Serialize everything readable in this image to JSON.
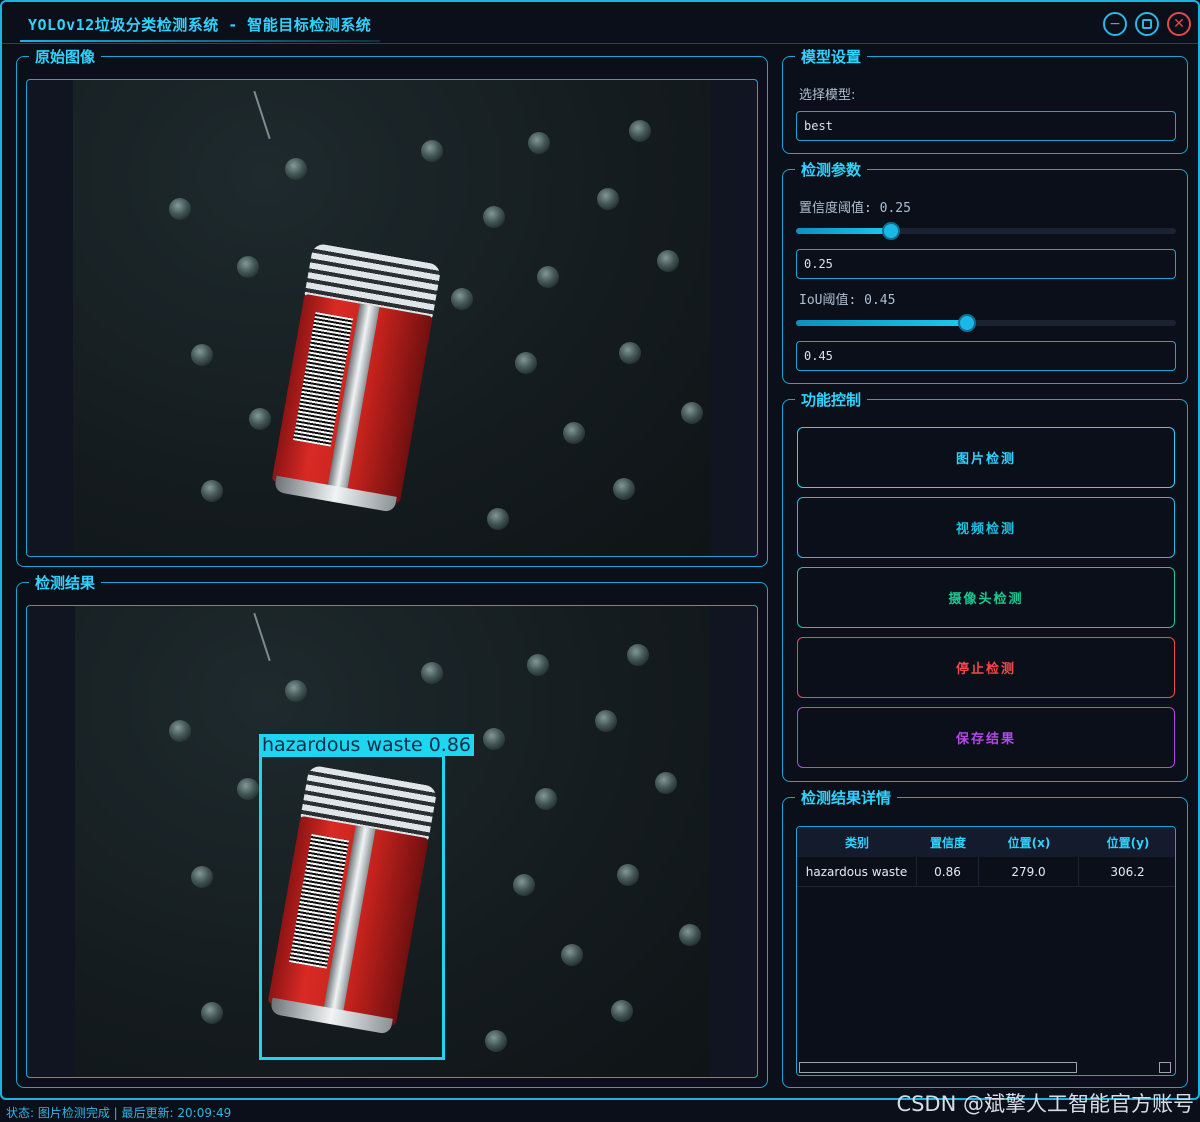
{
  "window": {
    "title": "YOLOv12垃圾分类检测系统 - 智能目标检测系统",
    "controls": [
      "minimize",
      "maximize",
      "close"
    ]
  },
  "panels": {
    "original": {
      "title": "原始图像"
    },
    "result": {
      "title": "检测结果"
    }
  },
  "detection_overlay": {
    "label": "hazardous waste 0.86",
    "color": "#1ed6f0"
  },
  "model": {
    "group_title": "模型设置",
    "select_label": "选择模型:",
    "selected": "best"
  },
  "params": {
    "group_title": "检测参数",
    "confidence_label": "置信度阈值: 0.25",
    "confidence_value": "0.25",
    "confidence_fraction": 0.25,
    "iou_label": "IoU阈值: 0.45",
    "iou_value": "0.45",
    "iou_fraction": 0.45
  },
  "controls": {
    "group_title": "功能控制",
    "image_detect": "图片检测",
    "video_detect": "视频检测",
    "camera_detect": "摄像头检测",
    "stop_detect": "停止检测",
    "save_result": "保存结果"
  },
  "colors": {
    "accent": "#1aa6d4",
    "image_btn": "#2fd3ff",
    "video_btn": "#1ec0e0",
    "camera_btn": "#19c990",
    "stop_btn": "#f04a4a",
    "save_btn": "#b04ae8"
  },
  "details": {
    "group_title": "检测结果详情",
    "columns": [
      "类别",
      "置信度",
      "位置(x)",
      "位置(y)"
    ],
    "rows": [
      [
        "hazardous waste",
        "0.86",
        "279.0",
        "306.2"
      ]
    ]
  },
  "status": {
    "text": "状态: 图片检测完成 | 最后更新: 20:09:49"
  },
  "watermark": "CSDN @斌擎人工智能官方账号"
}
